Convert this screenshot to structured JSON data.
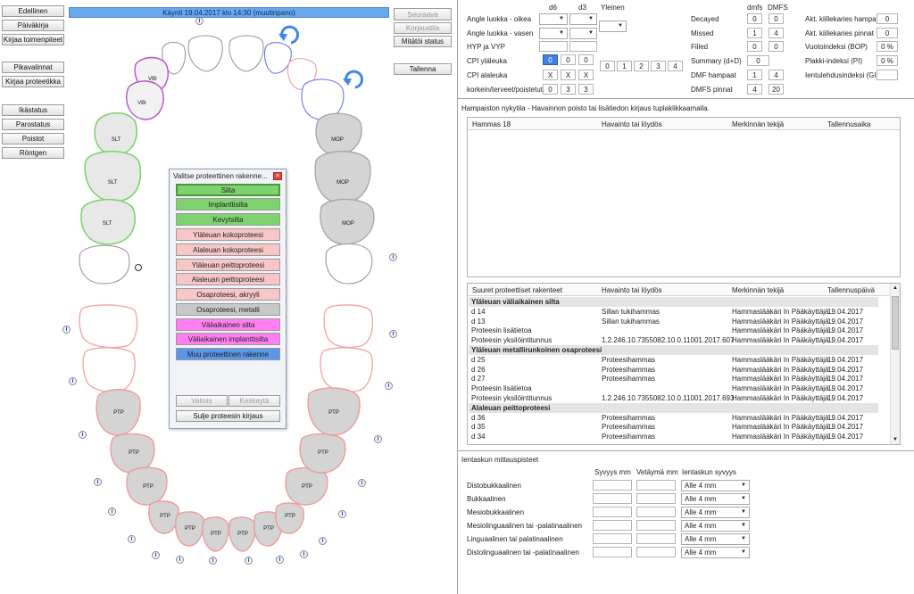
{
  "left_nav": {
    "edellinen": "Edellinen",
    "paivakirja": "Päiväkirja",
    "kirjaa_toimenpiteet": "Kirjaa toimenpiteet",
    "pikavalinnat": "Pikavalinnat",
    "kirjaa_proteetikka": "Kirjaa proteetikka",
    "ikastatus": "Ikästatus",
    "parostatus": "Parostatus",
    "poistot": "Poistot",
    "rontgen": "Röntgen"
  },
  "visit_bar": "Käynti 19.04.2017 klo 14:30 (muutinpano)",
  "right_nav": {
    "seuraava": "Seuraava",
    "korjaustila": "Korjaustila",
    "mitatoi_status": "Mitätöi status",
    "tallenna": "Tallenna"
  },
  "teeth_labels": {
    "vbi": "VBI",
    "slt": "SLT",
    "mop": "MOP",
    "ptp": "PTP"
  },
  "modal": {
    "title": "Valitse proteettinen rakenne...",
    "options": [
      "Silta",
      "Implanttisilta",
      "Kevytsilta",
      "Yläleuan kokoproteesi",
      "Alaleuan kokoproteesi",
      "Yläleuan peittoproteesi",
      "Alaleuan peittoproteesi",
      "Osaproteesi, akryyli",
      "Osaproteesi, metalli",
      "Väliaikainen silta",
      "Väliaikainen implanttisilta",
      "Muu proteettinen rakenne"
    ],
    "valmis": "Valmis",
    "keskeyta": "Keskeytä",
    "sulje": "Sulje proteesin kirjaus"
  },
  "indices": {
    "col_d6": "d6",
    "col_d3": "d3",
    "col_yleinen": "Yleinen",
    "angle_oikea": "Angle luokka - oikea",
    "angle_vasen": "Angle luokka - vasen",
    "hyp_vyp": "HYP ja VYP",
    "cpi_yla": "CPI yläleuka",
    "cpi_ala": "CPI alaleuka",
    "korkein": "korkein/terveet/poistetut",
    "cpi_yla_vals": [
      "0",
      "0",
      "0"
    ],
    "cpi_ala_vals": [
      "X",
      "X",
      "X"
    ],
    "korkein_vals": [
      "0",
      "3",
      "3"
    ],
    "yleinen_buttons": [
      "0",
      "1",
      "2",
      "3",
      "4"
    ],
    "col_dmfs": "dmfs",
    "col_DMFS": "DMFS",
    "decayed": "Decayed",
    "missed": "Missed",
    "filled": "Filled",
    "summary": "Summary (d+D)",
    "dmf_hampaat": "DMF hampaat",
    "dmfs_pinnat": "DMFS pinnat",
    "decayed_vals": [
      "0",
      "0"
    ],
    "missed_vals": [
      "1",
      "4"
    ],
    "filled_vals": [
      "0",
      "0"
    ],
    "summary_val": "0",
    "dmf_hampaat_vals": [
      "1",
      "4"
    ],
    "dmfs_pinnat_vals": [
      "4",
      "20"
    ],
    "akt_hampaat": "Akt. kiillekaries hampaat",
    "akt_pinnat": "Akt. kiillekaries pinnat",
    "vuoto": "Vuotoindeksi (BOP)",
    "plakki": "Plakki-indeksi (PI)",
    "ientulehdus": "Ientulehdusindeksi (GI)",
    "akt_hampaat_val": "0",
    "akt_pinnat_val": "0",
    "vuoto_val": "0 %",
    "plakki_val": "0 %"
  },
  "findings": {
    "caption": "Hampaiston nykytila  -  Havainnon poisto tai lisätiedon kirjaus tuplaklikkaamalla.",
    "headers": [
      "Hammas 18",
      "Havainto tai löydös",
      "Merkinnän tekijä",
      "Tallennusaika"
    ]
  },
  "prosthetics": {
    "headers": [
      "Suuret proteettiset rakenteet",
      "Havainto tai löydös",
      "Merkinnän tekijä",
      "Tallennuspäivä"
    ],
    "rows": [
      {
        "type": "group",
        "c1": "Yläleuan väliaikainen silta"
      },
      {
        "c1": "d 14",
        "c2": "Sillan tukihammas",
        "c3": "Hammaslääkäri In Pääkäyttäjä...",
        "c4": "19.04.2017"
      },
      {
        "c1": "d 13",
        "c2": "Sillan tukihammas",
        "c3": "Hammaslääkäri In Pääkäyttäjä...",
        "c4": "19.04.2017"
      },
      {
        "c1": "Proteesin lisätietoa",
        "c2": "",
        "c3": "Hammaslääkäri In Pääkäyttäjä...",
        "c4": "19.04.2017"
      },
      {
        "c1": "Proteesin yksilöintitunnus",
        "c2": "1.2.246.10.7355082.10.0.11001.2017.607",
        "c3": "Hammaslääkäri In Pääkäyttäjä...",
        "c4": "19.04.2017"
      },
      {
        "type": "group",
        "c1": "Yläleuan metallirunkoinen osaproteesi"
      },
      {
        "c1": "d 25",
        "c2": "Proteesihammas",
        "c3": "Hammaslääkäri In Pääkäyttäjä...",
        "c4": "19.04.2017"
      },
      {
        "c1": "d 26",
        "c2": "Proteesihammas",
        "c3": "Hammaslääkäri In Pääkäyttäjä...",
        "c4": "19.04.2017"
      },
      {
        "c1": "d 27",
        "c2": "Proteesihammas",
        "c3": "Hammaslääkäri In Pääkäyttäjä...",
        "c4": "19.04.2017"
      },
      {
        "c1": "Proteesin lisätietoa",
        "c2": "",
        "c3": "Hammaslääkäri In Pääkäyttäjä...",
        "c4": "19.04.2017"
      },
      {
        "c1": "Proteesin yksilöintitunnus",
        "c2": "1.2.246.10.7355082.10.0.11001.2017.693",
        "c3": "Hammaslääkäri In Pääkäyttäjä...",
        "c4": "19.04.2017"
      },
      {
        "type": "group",
        "c1": "Alaleuan peittoproteesi"
      },
      {
        "c1": "d 36",
        "c2": "Proteesihammas",
        "c3": "Hammaslääkäri In Pääkäyttäjä...",
        "c4": "19.04.2017"
      },
      {
        "c1": "d 35",
        "c2": "Proteesihammas",
        "c3": "Hammaslääkäri In Pääkäyttäjä...",
        "c4": "19.04.2017"
      },
      {
        "c1": "d 34",
        "c2": "Proteesihammas",
        "c3": "Hammaslääkäri In Pääkäyttäjä...",
        "c4": "19.04.2017"
      }
    ]
  },
  "pockets": {
    "title": "Ientaskun mittauspisteet",
    "col_syvyys": "Syvyys mm",
    "col_vetayma": "Vetäymä mm",
    "col_ientasku": "Ientaskun syvyys",
    "rows": [
      "Distobukkaalinen",
      "Bukkaalinen",
      "Mesiobukkaalinen",
      "Mesiolinguaalinen tai -palatinaalinen",
      "Linguaalinen tai palatinaalinen",
      "Distolinguaalinen tai -palatinaalinen"
    ],
    "select_value": "Alle 4 mm"
  },
  "colors": {
    "green": "#7ed36f",
    "pink": "#f4a7a7",
    "gray": "#c4c4c4",
    "magenta": "#ff7ff2",
    "blue": "#3f86e8",
    "purple": "#a848c8"
  }
}
